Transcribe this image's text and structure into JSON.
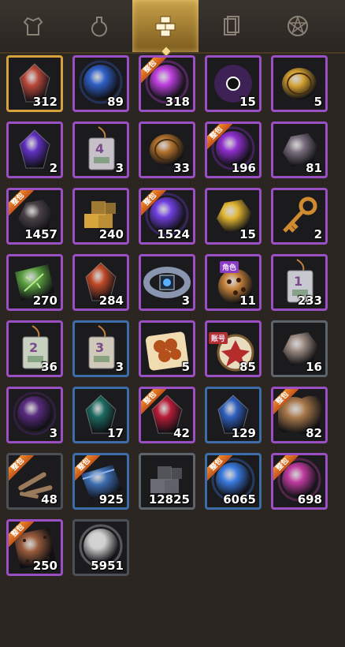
{
  "tabs": [
    {
      "icon": "armor-icon",
      "active": false
    },
    {
      "icon": "potion-icon",
      "active": false
    },
    {
      "icon": "cubes-icon",
      "active": true
    },
    {
      "icon": "cards-icon",
      "active": false
    },
    {
      "icon": "pentagram-icon",
      "active": false
    }
  ],
  "items": [
    {
      "name": "red-crystal",
      "count": "312",
      "rarity": "gold",
      "hue": "#b8483a",
      "shape": "gem"
    },
    {
      "name": "blue-gold-orb",
      "count": "89",
      "rarity": "purple",
      "hue": "#3060c8",
      "shape": "orb"
    },
    {
      "name": "purple-energy-orb",
      "count": "318",
      "rarity": "purple",
      "hue": "#c040e0",
      "shape": "orb",
      "ribbon": "整包"
    },
    {
      "name": "dark-star-orb",
      "count": "15",
      "rarity": "purple",
      "hue": "#8030c0",
      "shape": "star"
    },
    {
      "name": "gold-coin",
      "count": "5",
      "rarity": "purple",
      "hue": "#d4a030",
      "shape": "coin"
    },
    {
      "name": "purple-gem-ring",
      "count": "2",
      "rarity": "purple",
      "hue": "#6030c0",
      "shape": "gem"
    },
    {
      "name": "tag-4",
      "count": "3",
      "rarity": "purple",
      "hue": "#c8c0c8",
      "shape": "tag",
      "tag_number": "4"
    },
    {
      "name": "bronze-seal",
      "count": "33",
      "rarity": "purple",
      "hue": "#b0702c",
      "shape": "coin"
    },
    {
      "name": "purple-energy-orb-2",
      "count": "196",
      "rarity": "purple",
      "hue": "#9030d0",
      "shape": "orb",
      "ribbon": "整包"
    },
    {
      "name": "gray-stone",
      "count": "81",
      "rarity": "purple",
      "hue": "#7a6e7e",
      "shape": "stone"
    },
    {
      "name": "black-ore",
      "count": "1457",
      "rarity": "purple",
      "hue": "#4a4246",
      "shape": "stone",
      "ribbon": "整包"
    },
    {
      "name": "gold-cubes",
      "count": "240",
      "rarity": "purple",
      "hue": "#d8a43c",
      "shape": "cubes"
    },
    {
      "name": "purple-energy-orb-3",
      "count": "1524",
      "rarity": "purple",
      "hue": "#7040e0",
      "shape": "orb",
      "ribbon": "整包"
    },
    {
      "name": "gold-nuggets",
      "count": "15",
      "rarity": "purple",
      "hue": "#e0b430",
      "shape": "stone"
    },
    {
      "name": "gold-key",
      "count": "2",
      "rarity": "purple",
      "hue": "#d08a30",
      "shape": "key"
    },
    {
      "name": "green-leaf-scroll",
      "count": "270",
      "rarity": "purple",
      "hue": "#5aa040",
      "shape": "leaf"
    },
    {
      "name": "red-fire-gem",
      "count": "284",
      "rarity": "purple",
      "hue": "#c04a28",
      "shape": "gem"
    },
    {
      "name": "silver-bracelet",
      "count": "3",
      "rarity": "purple",
      "hue": "#8a96b0",
      "shape": "ring"
    },
    {
      "name": "cookie",
      "count": "11",
      "rarity": "purple",
      "hue": "#c8843c",
      "shape": "cookie",
      "tag": "角色"
    },
    {
      "name": "tag-1",
      "count": "233",
      "rarity": "purple",
      "hue": "#c8c8d0",
      "shape": "tag",
      "tag_number": "1"
    },
    {
      "name": "tag-2",
      "count": "36",
      "rarity": "purple",
      "hue": "#c8d0c0",
      "shape": "tag",
      "tag_number": "2"
    },
    {
      "name": "tag-3",
      "count": "3",
      "rarity": "blue",
      "hue": "#d0c8b8",
      "shape": "tag",
      "tag_number": "3"
    },
    {
      "name": "meat-dish",
      "count": "5",
      "rarity": "purple",
      "hue": "#b4501c",
      "shape": "food"
    },
    {
      "name": "emblem-badge",
      "count": "85",
      "rarity": "purple",
      "hue": "#b42c2c",
      "shape": "badge",
      "tag_red": "账号"
    },
    {
      "name": "rough-stone",
      "count": "16",
      "rarity": "gray",
      "hue": "#9a8a80",
      "shape": "stone"
    },
    {
      "name": "purple-sphere",
      "count": "3",
      "rarity": "purple",
      "hue": "#5a2c80",
      "shape": "orb"
    },
    {
      "name": "teal-gem",
      "count": "17",
      "rarity": "blue",
      "hue": "#1c6a60",
      "shape": "gem"
    },
    {
      "name": "ruby",
      "count": "42",
      "rarity": "purple",
      "hue": "#b81c38",
      "shape": "gem",
      "ribbon": "整包"
    },
    {
      "name": "blue-sapphire",
      "count": "129",
      "rarity": "blue",
      "hue": "#3060c0",
      "shape": "gem"
    },
    {
      "name": "leather-hide",
      "count": "82",
      "rarity": "purple",
      "hue": "#a8784a",
      "shape": "hide",
      "ribbon": "整包"
    },
    {
      "name": "wood-sticks",
      "count": "48",
      "rarity": "dark",
      "hue": "#9a7a5c",
      "shape": "sticks",
      "ribbon": "整包"
    },
    {
      "name": "blue-cloth",
      "count": "925",
      "rarity": "blue",
      "hue": "#3c6cb0",
      "shape": "cloth",
      "ribbon": "整包"
    },
    {
      "name": "gray-cubes",
      "count": "12825",
      "rarity": "gray",
      "hue": "#6a6e74",
      "shape": "cubes"
    },
    {
      "name": "blue-energy-orb",
      "count": "6065",
      "rarity": "blue",
      "hue": "#3a7ae0",
      "shape": "orb",
      "ribbon": "整包"
    },
    {
      "name": "rainbow-orb",
      "count": "698",
      "rarity": "purple",
      "hue": "#c03ca0",
      "shape": "orb",
      "ribbon": "整包"
    },
    {
      "name": "copper-plate",
      "count": "250",
      "rarity": "purple",
      "hue": "#9a5c3c",
      "shape": "plate",
      "ribbon": "整包"
    },
    {
      "name": "white-energy-orb",
      "count": "5951",
      "rarity": "dark",
      "hue": "#d0d0d0",
      "shape": "orb"
    }
  ]
}
